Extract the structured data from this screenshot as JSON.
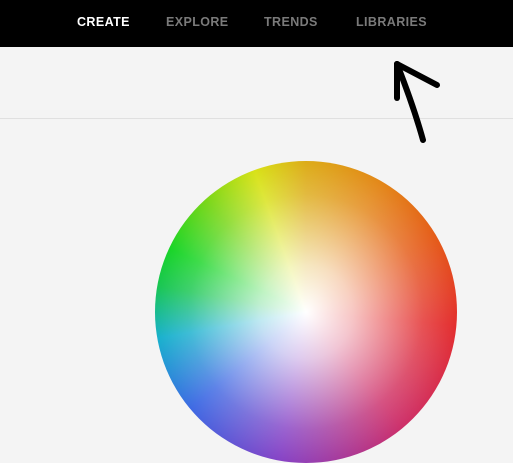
{
  "nav": {
    "items": [
      {
        "label": "CREATE",
        "active": true
      },
      {
        "label": "EXPLORE",
        "active": false
      },
      {
        "label": "TRENDS",
        "active": false
      },
      {
        "label": "LIBRARIES",
        "active": false
      }
    ]
  },
  "colors": {
    "topbar": "#000000",
    "active_tab": "#ffffff",
    "inactive_tab": "#7a7a7a",
    "background": "#f4f4f4"
  },
  "icons": {
    "annotation": "hand-drawn-arrow-icon"
  }
}
